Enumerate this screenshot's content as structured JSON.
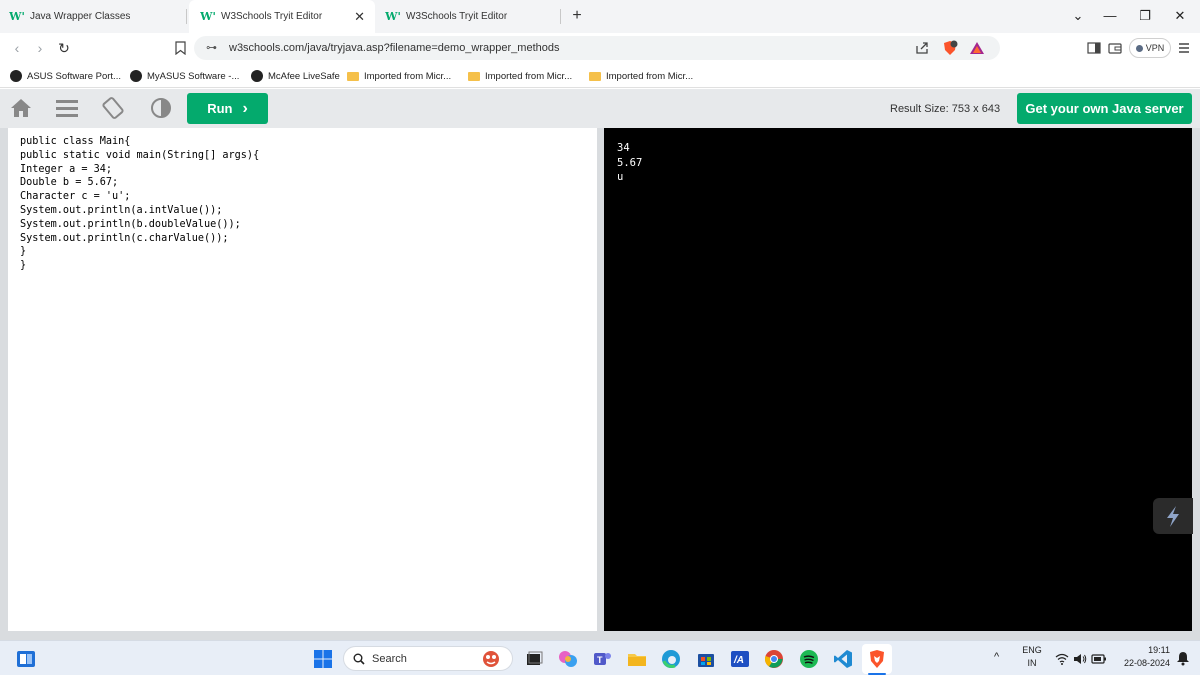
{
  "browser": {
    "tabs": [
      {
        "label": "Java Wrapper Classes",
        "active": false
      },
      {
        "label": "W3Schools Tryit Editor",
        "active": true
      },
      {
        "label": "W3Schools Tryit Editor",
        "active": false
      }
    ],
    "tab_favicon": "W'",
    "new_tab_symbol": "+",
    "tab_close_symbol": "✕",
    "window_controls": {
      "dropdown": "⌄",
      "minimize": "—",
      "restore": "❐",
      "close": "✕"
    },
    "nav": {
      "back": "‹",
      "forward": "›",
      "reload": "↻"
    },
    "address": {
      "tune_icon": "⊶",
      "url": "w3schools.com/java/tryjava.asp?filename=demo_wrapper_methods"
    },
    "vpn_label": "VPN",
    "bookmarks": [
      {
        "label": "ASUS Software Port...",
        "icon": "circle-icon"
      },
      {
        "label": "MyASUS Software -...",
        "icon": "circle-icon"
      },
      {
        "label": "McAfee LiveSafe",
        "icon": "circle-icon"
      },
      {
        "label": "Imported from Micr...",
        "icon": "folder-icon"
      },
      {
        "label": "Imported from Micr...",
        "icon": "folder-icon"
      },
      {
        "label": "Imported from Micr...",
        "icon": "folder-icon"
      }
    ]
  },
  "tryit": {
    "run_label": "Run",
    "run_chevron": "›",
    "result_size": "Result Size: 753 x 643",
    "get_server_label": "Get your own Java server"
  },
  "editor": {
    "lines": [
      "public class Main{",
      "public static void main(String[] args){",
      "Integer a = 34;",
      "Double b = 5.67;",
      "Character c = 'u';",
      "System.out.println(a.intValue());",
      "System.out.println(b.doubleValue());",
      "System.out.println(c.charValue());",
      "}",
      "}"
    ]
  },
  "result": {
    "output_lines": [
      "34",
      "5.67",
      "u"
    ]
  },
  "taskbar": {
    "search_label": "Search",
    "language": "ENG",
    "region": "IN",
    "time": "19:11",
    "date": "22-08-2024",
    "tray_chevron": "^"
  },
  "colors": {
    "w3_green": "#04aa6d",
    "toolbar_bg": "#e7e9eb",
    "result_bg": "#000000"
  }
}
